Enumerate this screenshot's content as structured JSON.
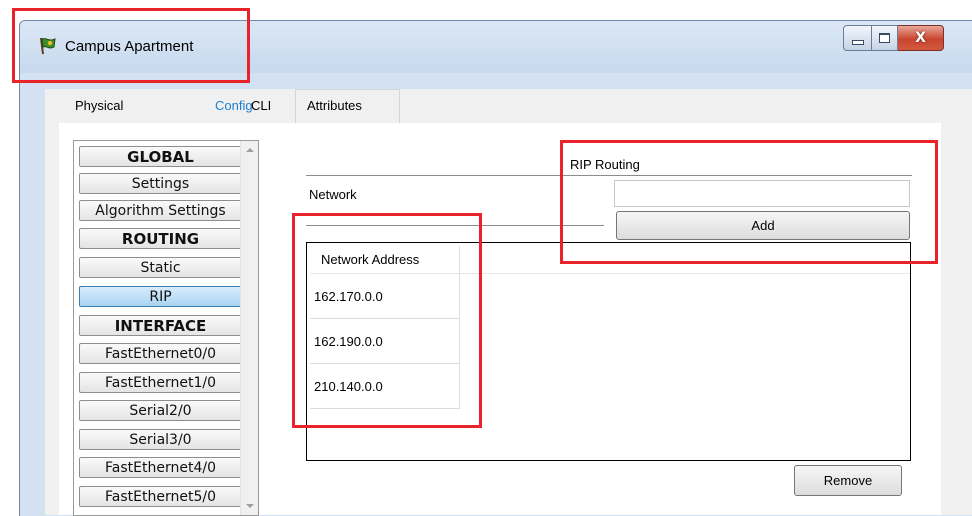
{
  "window": {
    "title": "Campus Apartment",
    "icon": "router-flag-icon",
    "controls": [
      "minimize",
      "maximize",
      "close"
    ],
    "close_glyph": "X"
  },
  "tabs": [
    {
      "label": "Physical",
      "active": false
    },
    {
      "label": "Config",
      "active": true
    },
    {
      "label": "CLI",
      "active": false
    },
    {
      "label": "Attributes",
      "active": false
    }
  ],
  "sidebar": {
    "items": [
      {
        "label": "GLOBAL",
        "type": "header"
      },
      {
        "label": "Settings",
        "type": "item"
      },
      {
        "label": "Algorithm Settings",
        "type": "item"
      },
      {
        "label": "ROUTING",
        "type": "header"
      },
      {
        "label": "Static",
        "type": "item"
      },
      {
        "label": "RIP",
        "type": "item",
        "selected": true
      },
      {
        "label": "INTERFACE",
        "type": "header"
      },
      {
        "label": "FastEthernet0/0",
        "type": "item"
      },
      {
        "label": "FastEthernet1/0",
        "type": "item"
      },
      {
        "label": "Serial2/0",
        "type": "item"
      },
      {
        "label": "Serial3/0",
        "type": "item"
      },
      {
        "label": "FastEthernet4/0",
        "type": "item"
      },
      {
        "label": "FastEthernet5/0",
        "type": "item"
      }
    ]
  },
  "rip": {
    "title": "RIP Routing",
    "network_label": "Network",
    "network_value": "",
    "add_label": "Add",
    "remove_label": "Remove",
    "table": {
      "header": "Network Address",
      "rows": [
        "162.170.0.0",
        "162.190.0.0",
        "210.140.0.0"
      ]
    }
  },
  "colors": {
    "highlight": "#e8232a",
    "active_tab": "#1e7fcf",
    "selected_item": "#a9d3f3"
  }
}
